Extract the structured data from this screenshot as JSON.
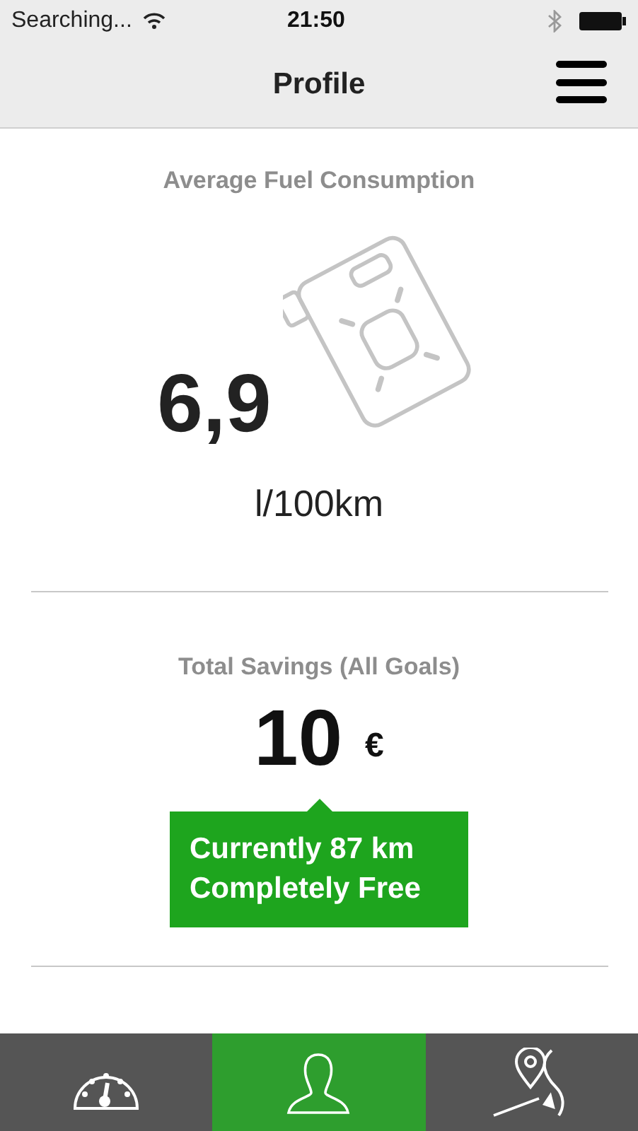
{
  "status_bar": {
    "carrier": "Searching...",
    "time": "21:50"
  },
  "nav": {
    "title": "Profile"
  },
  "fuel": {
    "title": "Average Fuel Consumption",
    "value": "6,9",
    "unit": "l/100km"
  },
  "savings": {
    "title": "Total Savings (All Goals)",
    "value": "10",
    "currency": "€",
    "callout_lines": [
      "Currently 87 km",
      "Completely Free"
    ]
  },
  "tabs": [
    {
      "kind": "dashboard",
      "selected": false
    },
    {
      "kind": "profile",
      "selected": true
    },
    {
      "kind": "route",
      "selected": false
    }
  ]
}
